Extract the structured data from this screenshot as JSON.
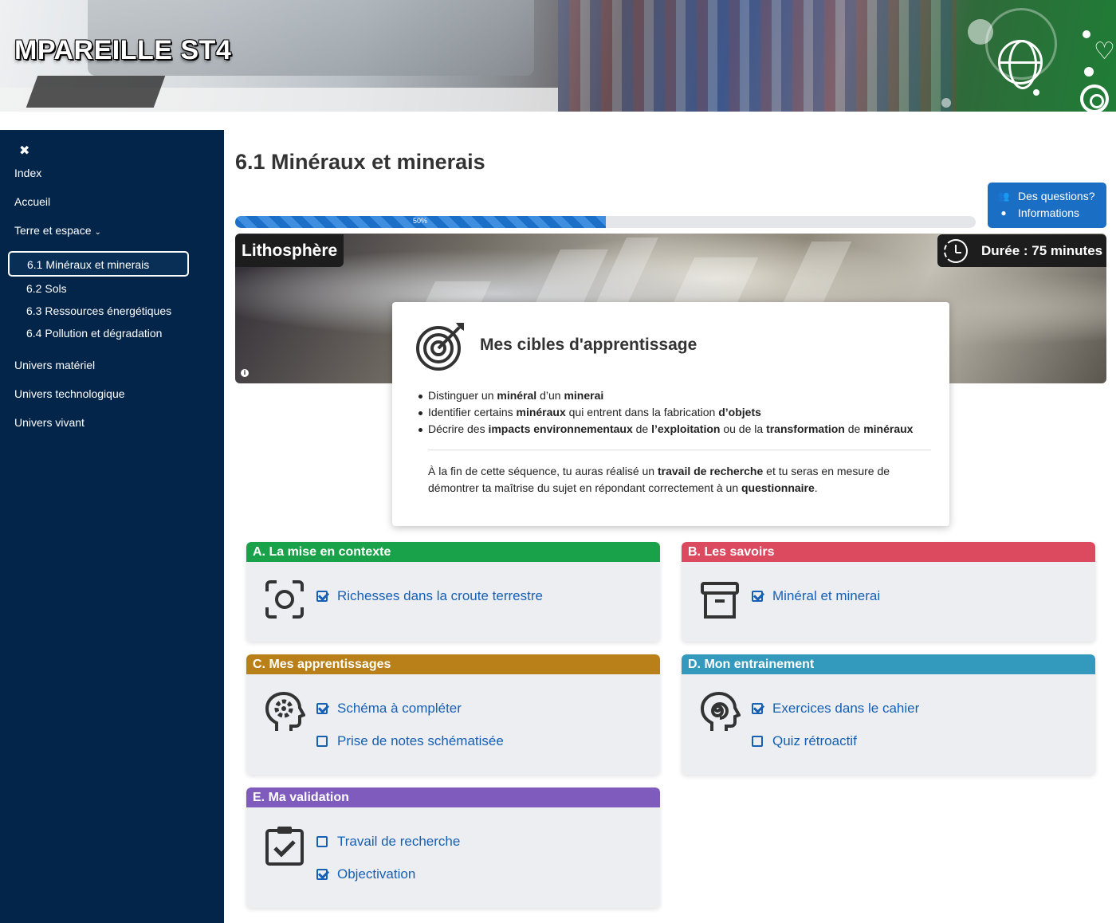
{
  "site": {
    "title": "MPAREILLE ST4"
  },
  "sidebar": {
    "items": [
      {
        "label": "Index"
      },
      {
        "label": "Accueil"
      },
      {
        "label": "Terre et espace"
      },
      {
        "label": "Univers matériel"
      },
      {
        "label": "Univers technologique"
      },
      {
        "label": "Univers vivant"
      }
    ],
    "subitems": [
      {
        "label": "6.1 Minéraux et minerais",
        "active": true
      },
      {
        "label": "6.2 Sols"
      },
      {
        "label": "6.3 Ressources énergétiques"
      },
      {
        "label": "6.4 Pollution et dégradation"
      }
    ]
  },
  "page": {
    "title": "6.1 Minéraux et minerais"
  },
  "help": {
    "questions": "Des questions?",
    "info": "Informations"
  },
  "progress": {
    "value": 50,
    "label": "50%"
  },
  "hero": {
    "tag": "Lithosphère",
    "duration": "Durée : 75 minutes"
  },
  "goals": {
    "title": "Mes cibles d'apprentissage",
    "items": [
      [
        {
          "t": "Distinguer un "
        },
        {
          "t": "minéral",
          "b": true
        },
        {
          "t": " d’un "
        },
        {
          "t": "minerai",
          "b": true
        }
      ],
      [
        {
          "t": "Identifier certains "
        },
        {
          "t": "minéraux",
          "b": true
        },
        {
          "t": " qui entrent dans la fabrication "
        },
        {
          "t": "d’objets",
          "b": true
        }
      ],
      [
        {
          "t": "Décrire des "
        },
        {
          "t": "impacts environnementaux",
          "b": true
        },
        {
          "t": " de "
        },
        {
          "t": "l’exploitation",
          "b": true
        },
        {
          "t": " ou de la "
        },
        {
          "t": "transformation",
          "b": true
        },
        {
          "t": " de "
        },
        {
          "t": "minéraux",
          "b": true
        }
      ]
    ],
    "paragraph": [
      {
        "t": "À la fin de cette séquence, tu auras réalisé un "
      },
      {
        "t": "travail de recherche",
        "b": true
      },
      {
        "t": " et tu seras en mesure de démontrer ta maîtrise du sujet en répondant correctement à un "
      },
      {
        "t": "questionnaire",
        "b": true
      },
      {
        "t": "."
      }
    ]
  },
  "sections": [
    {
      "title": "A. La mise en contexte",
      "color": "#1aa24a",
      "icon": "focus-icon",
      "tasks": [
        {
          "label": "Richesses dans la croute terrestre",
          "done": true
        }
      ]
    },
    {
      "title": "B. Les savoirs",
      "color": "#dc4a60",
      "icon": "archive-icon",
      "tasks": [
        {
          "label": "Minéral et minerai",
          "done": true
        }
      ]
    },
    {
      "title": "C. Mes apprentissages",
      "color": "#b98019",
      "icon": "head-gear-icon",
      "tasks": [
        {
          "label": "Schéma à compléter",
          "done": true
        },
        {
          "label": "Prise de notes schématisée",
          "done": false
        }
      ]
    },
    {
      "title": "D. Mon entrainement",
      "color": "#3399bd",
      "icon": "head-spiral-icon",
      "tasks": [
        {
          "label": "Exercices dans le cahier",
          "done": true
        },
        {
          "label": "Quiz rétroactif",
          "done": false
        }
      ]
    },
    {
      "title": "E. Ma validation",
      "color": "#7e5bbd",
      "icon": "clipboard-check-icon",
      "tasks": [
        {
          "label": "Travail de recherche",
          "done": false
        },
        {
          "label": "Objectivation",
          "done": true
        }
      ]
    }
  ]
}
